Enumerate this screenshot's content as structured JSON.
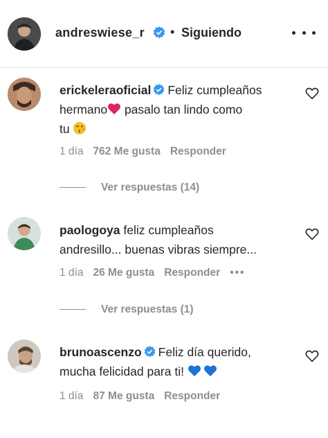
{
  "header": {
    "username": "andreswiese_r",
    "separator": "•",
    "follow_label": "Siguiendo",
    "more_icon": "ellipsis-icon"
  },
  "comments": [
    {
      "username": "erickeleraoficial",
      "verified": true,
      "text_1": "Feliz cumpleaños",
      "text_2": "hermano",
      "text_3": "pasalo tan lindo como",
      "text_4": "tu",
      "time": "1 día",
      "likes": "762 Me gusta",
      "reply": "Responder",
      "replies": "Ver respuestas (14)"
    },
    {
      "username": "paologoya",
      "verified": false,
      "text_1": "feliz cumpleaños",
      "text_2": "andresillo... buenas vibras siempre...",
      "time": "1 día",
      "likes": "26 Me gusta",
      "reply": "Responder",
      "more": "•••",
      "replies": "Ver respuestas (1)"
    },
    {
      "username": "brunoascenzo",
      "verified": true,
      "text_1": "Feliz día querido,",
      "text_2": "mucha felicidad para ti!",
      "time": "1 día",
      "likes": "87 Me gusta",
      "reply": "Responder"
    }
  ],
  "colors": {
    "text": "#262626",
    "muted": "#8e8e8e",
    "verified": "#3897f0",
    "heart_red": "#e0245e",
    "heart_blue": "#1d73d6"
  }
}
